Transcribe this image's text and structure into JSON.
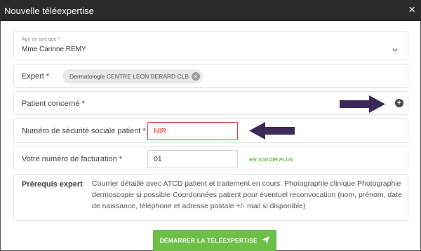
{
  "window": {
    "title": "Nouvelle téléexpertise",
    "close_glyph": "×"
  },
  "act_as": {
    "label": "Agir en tant que *",
    "value": "Mme Carinne REMY"
  },
  "expert": {
    "label": "Expert *",
    "chip": "Dermatologie CENTRE LEON BERARD CLB",
    "chip_remove_glyph": "×"
  },
  "patient": {
    "label": "Patient concerné *",
    "add_glyph": "+"
  },
  "nir": {
    "label": "Numéro de sécurité sociale patient *",
    "value": "NIR"
  },
  "billing": {
    "label": "Votre numéro de facturation *",
    "value": "01",
    "link": "EN SAVOIR PLUS"
  },
  "prereq": {
    "label": "Prérequis expert",
    "text": "Courrier détaillé avec ATCD patient et traitement en cours. Photographie clinique Photographie dermoscopie si possible Coordonnées patient pour éventuel reconvocation (nom, prénom, date de naissance, téléphone et adresse postale +/- mail si disponible)"
  },
  "submit": {
    "label": "DÉMARRER LA TÉLÉEXPERTISE",
    "icon": "send-icon"
  },
  "colors": {
    "titlebar": "#2b2b2b",
    "accent_green": "#6cbf47",
    "error_red": "#e53935",
    "annotation_arrow": "#3b2a57"
  }
}
